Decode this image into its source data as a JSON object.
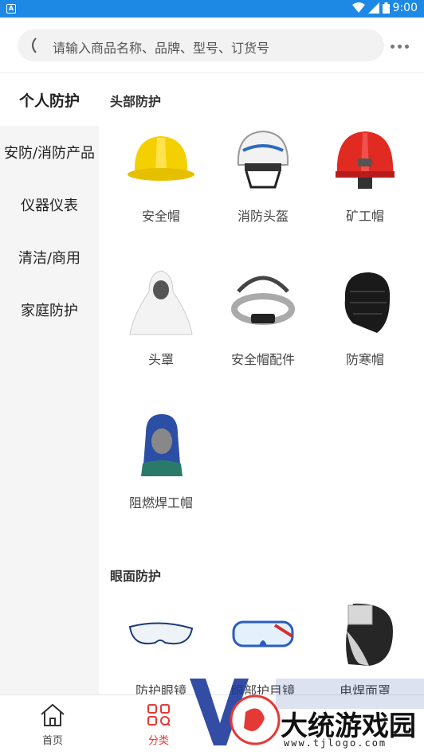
{
  "status": {
    "time": "9:00",
    "app_icon": "A"
  },
  "search": {
    "placeholder": "请输入商品名称、品牌、型号、订货号",
    "back_icon": "back-icon",
    "more_icon": "more-icon"
  },
  "sidebar": {
    "items": [
      {
        "label": "个人防护",
        "active": true
      },
      {
        "label": "安防/消防产品"
      },
      {
        "label": "仪器仪表"
      },
      {
        "label": "清洁/商用"
      },
      {
        "label": "家庭防护"
      }
    ]
  },
  "sections": [
    {
      "title": "头部防护",
      "items": [
        "安全帽",
        "消防头盔",
        "矿工帽",
        "头罩",
        "安全帽配件",
        "防寒帽",
        "阻燃焊工帽"
      ]
    },
    {
      "title": "眼面防护",
      "items": [
        "防护眼镜",
        "眼部护目镜",
        "电焊面罩"
      ]
    }
  ],
  "tabs": [
    {
      "label": "首页",
      "icon": "home-icon"
    },
    {
      "label": "分类",
      "icon": "category-icon",
      "active": true
    }
  ],
  "watermark": {
    "text": "大统游戏园",
    "url": "www.tjlogo.com"
  },
  "colors": {
    "status_bar": "#1e88e5",
    "active_tab": "#e53935",
    "sidebar_bg": "#f5f5f5"
  }
}
